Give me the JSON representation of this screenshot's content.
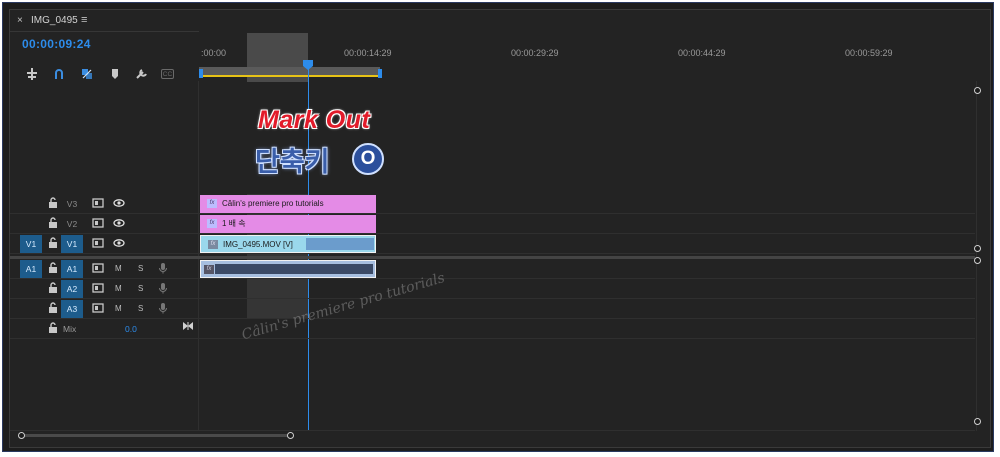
{
  "panel": {
    "close_glyph": "×",
    "sequence_name": "IMG_0495",
    "menu_glyph": "≡",
    "timecode": "00:00:09:24"
  },
  "toolbar": {
    "icons": [
      "insert-nest-icon",
      "snap-magnet-icon",
      "linked-selection-icon",
      "add-marker-icon",
      "wrench-settings-icon",
      "captions-icon"
    ],
    "captions_label": "CC"
  },
  "ruler": {
    "times": [
      ":00:00",
      "00:00:14:29",
      "00:00:29:29",
      "00:00:44:29",
      "00:00:59:29"
    ]
  },
  "overlay": {
    "title": "Mark Out",
    "subtitle_korean": "단축키",
    "shortcut_key": "O",
    "watermark": "Câlin's premiere pro tutorials"
  },
  "video_tracks": [
    {
      "source": "",
      "label": "V3",
      "clip": "Câlin's premiere pro tutorials",
      "clip_type": "fx"
    },
    {
      "source": "",
      "label": "V2",
      "clip": "1 배 속",
      "clip_type": "fx"
    },
    {
      "source": "V1",
      "label": "V1",
      "clip": "IMG_0495.MOV [V]",
      "clip_type": "video"
    }
  ],
  "audio_tracks": [
    {
      "source": "A1",
      "label": "A1",
      "mute": "M",
      "solo": "S"
    },
    {
      "source": "",
      "label": "A2",
      "mute": "M",
      "solo": "S"
    },
    {
      "source": "",
      "label": "A3",
      "mute": "M",
      "solo": "S"
    }
  ],
  "mix": {
    "label": "Mix",
    "value": "0.0"
  },
  "colors": {
    "accent_blue": "#2d8ceb",
    "adjustment_clip": "#e48be6",
    "video_clip": "#9ad8ec",
    "work_area": "#e7c316",
    "track_target": "#1d5c8c"
  }
}
